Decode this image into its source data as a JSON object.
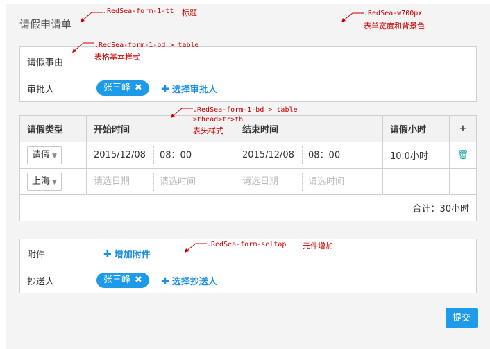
{
  "form": {
    "title": "请假申请单"
  },
  "info": {
    "reason_label": "请假事由",
    "approver_label": "审批人",
    "approver_tag": "张三峰",
    "approver_add": "选择审批人"
  },
  "table": {
    "headers": [
      "请假类型",
      "开始时间",
      "结束时间",
      "请假小时"
    ],
    "add_icon": "+",
    "rows": [
      {
        "type": "请假",
        "start_date": "2015/12/08",
        "start_time": "08：00",
        "end_date": "2015/12/08",
        "end_time": "08：00",
        "hours": "10.0小时"
      },
      {
        "type": "上海",
        "start_date": "请选日期",
        "start_time": "请选时间",
        "end_date": "请选日期",
        "end_time": "请选时间",
        "hours": ""
      }
    ],
    "total": "合计：30小时"
  },
  "attach": {
    "attach_label": "附件",
    "attach_add": "增加附件",
    "cc_label": "抄送人",
    "cc_tag": "张三峰",
    "cc_add": "选择抄送人"
  },
  "submit_label": "提交",
  "annotations": {
    "a1": ".RedSea-form-1-tt",
    "a1_cn": "标题",
    "a2": ".RedSea-w700px",
    "a2_cn": "表单宽度和背景色",
    "a3": ".RedSea-form-1-bd > table",
    "a3_cn": "表格基本样式",
    "a4_l1": ".RedSea-form-1-bd  > table",
    "a4_l2": ">thead>tr>th",
    "a4_cn": "表头样式",
    "a5": ".RedSea-form-seltap",
    "a5_cn": "元件增加"
  },
  "icons": {
    "close": "close-icon",
    "plus": "plus-icon",
    "trash": "trash-icon",
    "dropdown": "chevron-down-icon"
  },
  "colors": {
    "accent": "#1e9be8",
    "annotation": "#cc0000",
    "trash": "#1aa3a3"
  }
}
